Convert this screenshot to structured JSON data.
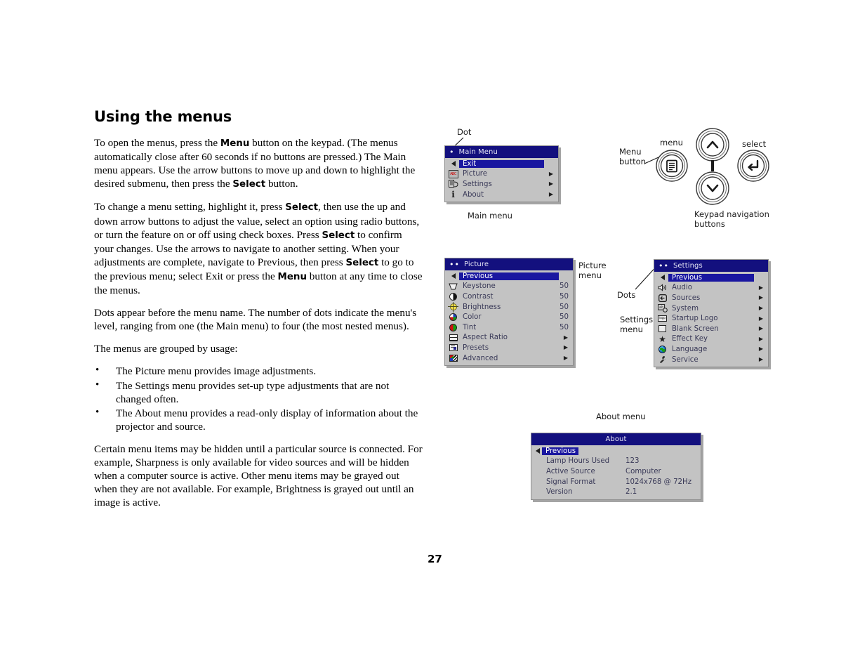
{
  "page": {
    "title": "Using the menus",
    "number": "27"
  },
  "body": {
    "p1_parts": [
      {
        "t": "To open the menus, press the ",
        "b": false
      },
      {
        "t": "Menu",
        "b": true
      },
      {
        "t": " button on the keypad. (The menus automatically close after 60 seconds if no buttons are pressed.) The Main menu appears. Use the arrow buttons to move up and down to highlight the desired submenu, then press the ",
        "b": false
      },
      {
        "t": "Select",
        "b": true
      },
      {
        "t": " button.",
        "b": false
      }
    ],
    "p2_parts": [
      {
        "t": "To change a menu setting, highlight it, press ",
        "b": false
      },
      {
        "t": "Select",
        "b": true
      },
      {
        "t": ", then use the up and down arrow buttons to adjust the value, select an option using radio buttons, or turn the feature on or off using check boxes. Press ",
        "b": false
      },
      {
        "t": "Select",
        "b": true
      },
      {
        "t": " to confirm your changes. Use the arrows to navigate to another setting. When your adjustments are complete, navigate to Previous, then press ",
        "b": false
      },
      {
        "t": "Select",
        "b": true
      },
      {
        "t": " to go to the previous menu; select Exit or press the ",
        "b": false
      },
      {
        "t": "Menu",
        "b": true
      },
      {
        "t": " button at any time to close the menus.",
        "b": false
      }
    ],
    "p3": "Dots appear before the menu name. The number of dots indicate the menu's level, ranging from one (the Main menu) to four (the most nested menus).",
    "p4": "The menus are grouped by usage:",
    "bullets": [
      "The Picture menu provides image adjustments.",
      "The Settings menu provides set-up type adjustments that are not changed often.",
      "The About menu provides a read-only display of information about the projector and source."
    ],
    "p5": "Certain menu items may be hidden until a particular source is connected. For example, Sharpness is only available for video sources and will be hidden when a computer source is active. Other menu items may be grayed out when they are not available. For example, Brightness is grayed out until an image is active."
  },
  "callouts": {
    "dot": "Dot",
    "main_menu": "Main menu",
    "picture_menu": "Picture\nmenu",
    "dots": "Dots",
    "settings_menu": "Settings\nmenu",
    "about_menu": "About menu",
    "menu_button": "Menu\nbutton",
    "menu_label": "menu",
    "select_label": "select",
    "keypad_nav": "Keypad navigation\nbuttons"
  },
  "main_menu": {
    "dots": "•",
    "title": "Main Menu",
    "items": [
      {
        "icon": "back-arrow-icon",
        "label": "Exit",
        "value": "",
        "arrow": false,
        "selected": true
      },
      {
        "icon": "picture-abc-icon",
        "label": "Picture",
        "value": "",
        "arrow": true,
        "selected": false
      },
      {
        "icon": "settings-icon",
        "label": "Settings",
        "value": "",
        "arrow": true,
        "selected": false
      },
      {
        "icon": "info-icon",
        "label": "About",
        "value": "",
        "arrow": true,
        "selected": false
      }
    ]
  },
  "picture_menu": {
    "dots": "••",
    "title": "Picture",
    "items": [
      {
        "icon": "back-arrow-icon",
        "label": "Previous",
        "value": "",
        "arrow": false,
        "selected": true
      },
      {
        "icon": "keystone-icon",
        "label": "Keystone",
        "value": "50",
        "arrow": false,
        "selected": false
      },
      {
        "icon": "contrast-icon",
        "label": "Contrast",
        "value": "50",
        "arrow": false,
        "selected": false
      },
      {
        "icon": "brightness-icon",
        "label": "Brightness",
        "value": "50",
        "arrow": false,
        "selected": false
      },
      {
        "icon": "color-icon",
        "label": "Color",
        "value": "50",
        "arrow": false,
        "selected": false
      },
      {
        "icon": "tint-icon",
        "label": "Tint",
        "value": "50",
        "arrow": false,
        "selected": false
      },
      {
        "icon": "aspect-ratio-icon",
        "label": "Aspect Ratio",
        "value": "",
        "arrow": true,
        "selected": false
      },
      {
        "icon": "presets-icon",
        "label": "Presets",
        "value": "",
        "arrow": true,
        "selected": false
      },
      {
        "icon": "advanced-icon",
        "label": "Advanced",
        "value": "",
        "arrow": true,
        "selected": false
      }
    ]
  },
  "settings_menu": {
    "dots": "••",
    "title": "Settings",
    "items": [
      {
        "icon": "back-arrow-icon",
        "label": "Previous",
        "value": "",
        "arrow": false,
        "selected": true
      },
      {
        "icon": "audio-icon",
        "label": "Audio",
        "value": "",
        "arrow": true,
        "selected": false
      },
      {
        "icon": "sources-icon",
        "label": "Sources",
        "value": "",
        "arrow": true,
        "selected": false
      },
      {
        "icon": "system-icon",
        "label": "System",
        "value": "",
        "arrow": true,
        "selected": false
      },
      {
        "icon": "startup-logo-icon",
        "label": "Startup Logo",
        "value": "",
        "arrow": true,
        "selected": false
      },
      {
        "icon": "blank-screen-icon",
        "label": "Blank Screen",
        "value": "",
        "arrow": true,
        "selected": false
      },
      {
        "icon": "effect-key-star-icon",
        "label": "Effect Key",
        "value": "",
        "arrow": true,
        "selected": false
      },
      {
        "icon": "language-globe-icon",
        "label": "Language",
        "value": "",
        "arrow": true,
        "selected": false
      },
      {
        "icon": "service-wrench-icon",
        "label": "Service",
        "value": "",
        "arrow": true,
        "selected": false
      }
    ]
  },
  "about_menu": {
    "title": "About",
    "items": [
      {
        "label": "Previous",
        "value": "",
        "selected": true
      },
      {
        "label": "Lamp Hours Used",
        "value": "123",
        "selected": false
      },
      {
        "label": "Active Source",
        "value": "Computer",
        "selected": false
      },
      {
        "label": "Signal Format",
        "value": "1024x768 @ 72Hz",
        "selected": false
      },
      {
        "label": "Version",
        "value": "2.1",
        "selected": false
      }
    ]
  },
  "colors": {
    "osd_title_bg": "#13107e",
    "osd_panel_bg": "#c3c3c3",
    "osd_highlight": "#1a17a0",
    "osd_text": "#3a3a58"
  }
}
